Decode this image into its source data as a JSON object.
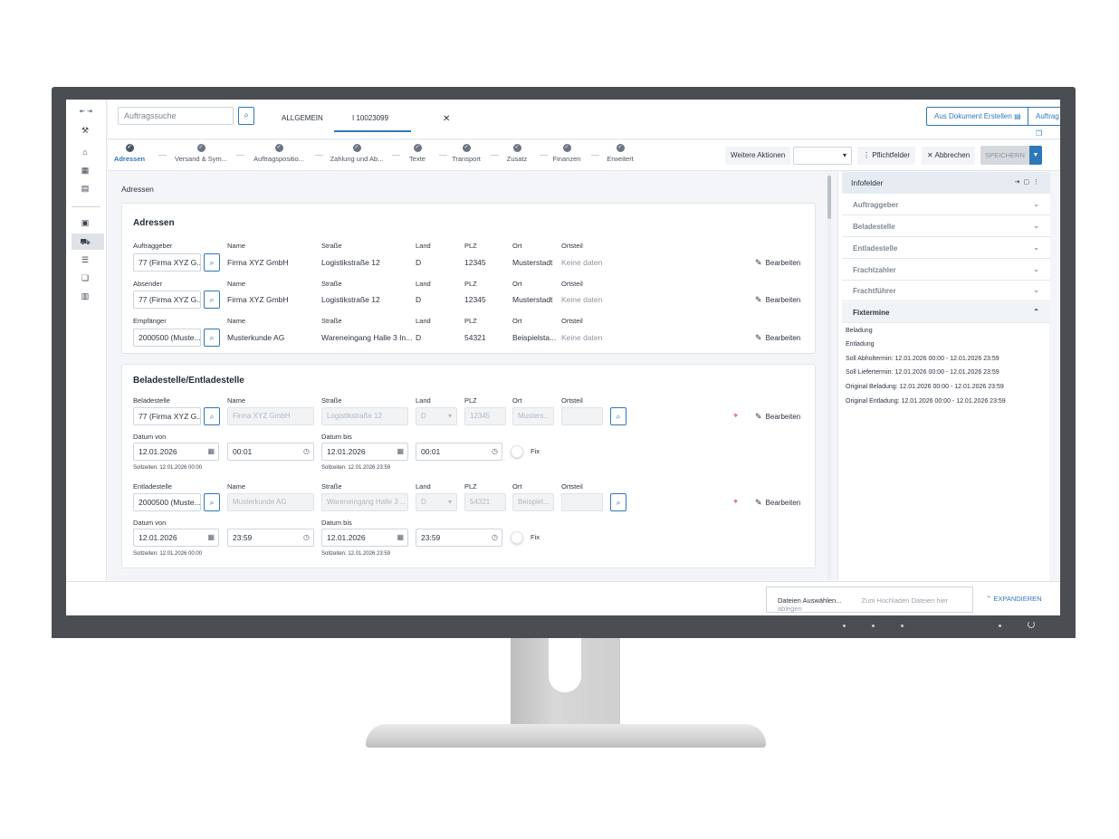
{
  "colors": {
    "accent": "#2f78b7",
    "danger": "#d13a3a",
    "bezel": "#4a4d52"
  },
  "search": {
    "placeholder": "Auftragssuche"
  },
  "tabs": [
    {
      "label": "ALLGEMEIN"
    },
    {
      "label": "I 10023099"
    }
  ],
  "header_buttons": {
    "from_document": "Aus Dokument Erstellen",
    "new_order": "Auftrag Neu"
  },
  "steps": [
    {
      "label": "Adressen"
    },
    {
      "label": "Versand & Sym..."
    },
    {
      "label": "Auftragspositio..."
    },
    {
      "label": "Zahlung und Ab..."
    },
    {
      "label": "Texte"
    },
    {
      "label": "Transport"
    },
    {
      "label": "Zusatz"
    },
    {
      "label": "Finanzen"
    },
    {
      "label": "Erweitert"
    }
  ],
  "actions": {
    "more": "Weitere Aktionen",
    "required": "Pflichtfelder",
    "cancel": "Abbrechen",
    "save": "SPEICHERN"
  },
  "main": {
    "title": "Adressen"
  },
  "addresses": {
    "title": "Adressen",
    "col_name": "Name",
    "col_street": "Straße",
    "col_country": "Land",
    "col_zip": "PLZ",
    "col_city": "Ort",
    "col_district": "Ortsteil",
    "edit": "Bearbeiten",
    "rows": [
      {
        "role": "Auftraggeber",
        "id": "77 (Firma XYZ G...",
        "name": "Firma XYZ GmbH",
        "street": "Logistikstraße 12",
        "country": "D",
        "zip": "12345",
        "city": "Musterstadt",
        "district": "Keine daten"
      },
      {
        "role": "Absender",
        "id": "77 (Firma XYZ G...",
        "name": "Firma XYZ GmbH",
        "street": "Logistikstraße 12",
        "country": "D",
        "zip": "12345",
        "city": "Musterstadt",
        "district": "Keine daten"
      },
      {
        "role": "Empfänger",
        "id": "2000500 (Muste...",
        "name": "Musterkunde AG",
        "street": "Wareneingang Halle 3 In...",
        "country": "D",
        "zip": "54321",
        "city": "Beispielsta...",
        "district": "Keine daten"
      }
    ]
  },
  "loading": {
    "title": "Beladestelle/Entladestelle",
    "date_from": "Datum von",
    "date_to": "Datum bis",
    "fix": "Fix",
    "load": {
      "role": "Beladestelle",
      "id": "77 (Firma XYZ G...",
      "name": "Firma XYZ GmbH",
      "street": "Logistikstraße 12",
      "country": "D",
      "zip": "12345",
      "city": "Musters...",
      "from_date": "12.01.2026",
      "from_time": "00:01",
      "to_date": "12.01.2026",
      "to_time": "00:01",
      "target_from": "Sollzeiten: 12.01.2026 00:00",
      "target_to": "Sollzeiten: 12.01.2026 23:59"
    },
    "unload": {
      "role": "Entladestelle",
      "id": "2000500 (Muste...",
      "name": "Musterkunde AG",
      "street": "Wareneingang Halle 3 ...",
      "country": "D",
      "zip": "54321",
      "city": "Beispiel...",
      "from_date": "12.01.2026",
      "from_time": "23:59",
      "to_date": "12.01.2026",
      "to_time": "23:59",
      "target_from": "Sollzeiten: 12.01.2026 00:00",
      "target_to": "Sollzeiten: 12.01.2026 23:59"
    }
  },
  "infofields": {
    "title": "Infofelder",
    "sections": [
      {
        "label": "Auftraggeber"
      },
      {
        "label": "Beladestelle"
      },
      {
        "label": "Entladestelle"
      },
      {
        "label": "Frachtzahler"
      },
      {
        "label": "Frachtführer"
      },
      {
        "label": "Fixtermine"
      }
    ],
    "fixtermine_lines": [
      "Beladung",
      "Entladung",
      "Soll Abholtermin: 12.01.2026 00:00 - 12.01.2026 23:59",
      "Soll Liefertermin: 12.01.2026 00:00 - 12.01.2026 23:59",
      "Original Beladung: 12.01.2026 00:00 - 12.01.2026 23:59",
      "Original Entladung: 12.01.2026 00:00 - 12.01.2026 23:59"
    ]
  },
  "upload": {
    "select": "Dateien Auswählen...",
    "hint": "Zum Hochladen Dateien hier ablegen",
    "expand": "EXPANDIEREN"
  }
}
